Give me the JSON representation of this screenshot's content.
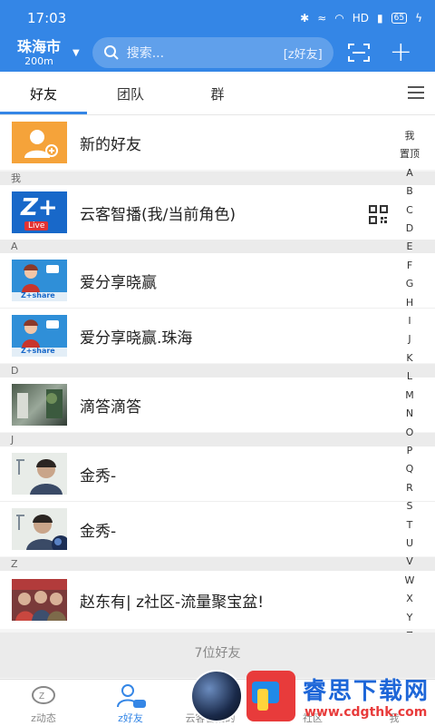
{
  "status_bar": {
    "time": "17:03",
    "network": "HD",
    "battery": "65"
  },
  "header": {
    "city": "珠海市",
    "distance": "200m",
    "search_placeholder": "搜索...",
    "search_scope": "[z好友]"
  },
  "tabs": [
    "好友",
    "团队",
    "群"
  ],
  "contacts": {
    "new_friend": "新的好友",
    "section_me": "我",
    "me": "云客智播(我/当前角色)",
    "section_a": "A",
    "a1": "爱分享晓赢",
    "a2": "爱分享晓赢.珠海",
    "section_d": "D",
    "d1": "滴答滴答",
    "section_j": "J",
    "j1": "金秀-",
    "j2": "金秀-",
    "section_z": "Z",
    "z1": "赵东有| z社区-流量聚宝盆!"
  },
  "avatar_labels": {
    "live_logo": "Z+",
    "live": "Live",
    "share_logo": "Z+share"
  },
  "index_bar": [
    "我",
    "置顶",
    "A",
    "B",
    "C",
    "D",
    "E",
    "F",
    "G",
    "H",
    "I",
    "J",
    "K",
    "L",
    "M",
    "N",
    "O",
    "P",
    "Q",
    "R",
    "S",
    "T",
    "U",
    "V",
    "W",
    "X",
    "Y",
    "Z",
    "#"
  ],
  "friend_count": "7位好友",
  "bottom_nav": {
    "dynamics": "z动态",
    "friends": "z好友",
    "broadcast": "云客智播的",
    "community": "社区",
    "me": "我"
  },
  "watermark": {
    "title": "睿思下载网",
    "url": "www.cdgthk.com"
  },
  "colors": {
    "primary": "#3486e6",
    "new_friend_orange": "#f5a33a"
  }
}
